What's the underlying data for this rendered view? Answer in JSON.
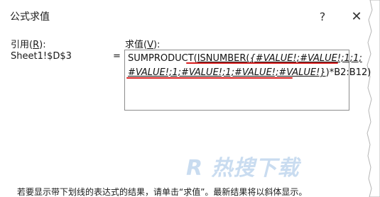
{
  "window": {
    "title": "公式求值",
    "help_glyph": "?",
    "close_glyph": "✕"
  },
  "reference": {
    "label_prefix": "引用(",
    "label_key": "R",
    "label_suffix": "):",
    "value": "Sheet1!$D$3"
  },
  "evaluation": {
    "label_prefix": "求值(",
    "label_key": "V",
    "label_suffix": "):",
    "equals": "=",
    "line1_plain": "SUMPRODUCT(",
    "line1_fn": "ISNUMBER(",
    "line1_args": "{#VALUE!;#VALUE!;1;1;",
    "line2_args": "#VALUE!;1;#VALUE!;1;#VALUE!;#VALUE!}",
    "line2_tail": ")*B2:B12)"
  },
  "footer": {
    "text": "若要显示带下划线的表达式的结果，请单击“求值”。最新结果将以斜体显示。"
  },
  "watermark": {
    "text": "R 热搜下载"
  },
  "colors": {
    "annotation_red": "#d81e1e",
    "border_gray": "#8c8c8c"
  }
}
